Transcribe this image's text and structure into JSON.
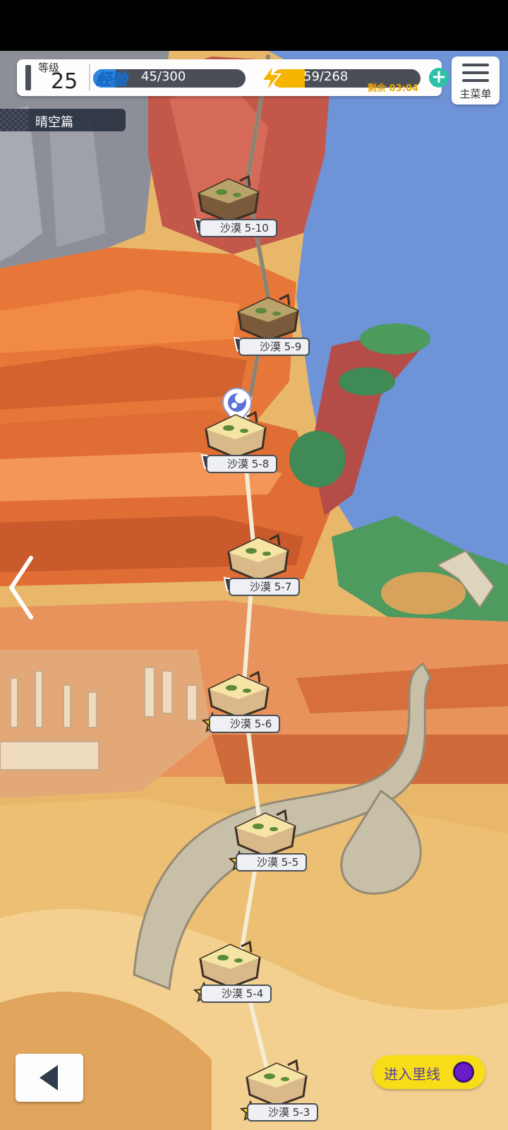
{
  "hud": {
    "level_label": "等级",
    "level_value": "25",
    "exp_label": "经验",
    "exp_value": "45/300",
    "exp_progress": 0.15,
    "stamina_value": "59/268",
    "stamina_progress": 0.22,
    "remaining_text": "剩余 03:04"
  },
  "menu": {
    "label": "主菜单"
  },
  "chapter": {
    "label": "晴空篇"
  },
  "stages": [
    {
      "label": "沙漠 5-10",
      "cleared": false
    },
    {
      "label": "沙漠 5-9",
      "cleared": false
    },
    {
      "label": "沙漠 5-8",
      "cleared": false,
      "current": true
    },
    {
      "label": "沙漠 5-7",
      "cleared": false
    },
    {
      "label": "沙漠 5-6",
      "cleared": true
    },
    {
      "label": "沙漠 5-5",
      "cleared": true
    },
    {
      "label": "沙漠 5-4",
      "cleared": true
    },
    {
      "label": "沙漠 5-3",
      "cleared": true
    }
  ],
  "enter_button": {
    "label": "进入里线"
  },
  "icons": {
    "menu": "hamburger-icon",
    "back": "back-arrow-icon",
    "left_page": "chevron-left-icon",
    "add": "plus-icon",
    "stamina": "lightning-icon",
    "current_marker": "location-pin-icon"
  },
  "colors": {
    "exp_fill": "#2d86e2",
    "stamina_fill": "#f4b400",
    "sky": "#6e93d6",
    "canyon": "#e0733a",
    "sand": "#e8b76a",
    "enter_button": "#f6dd18"
  }
}
